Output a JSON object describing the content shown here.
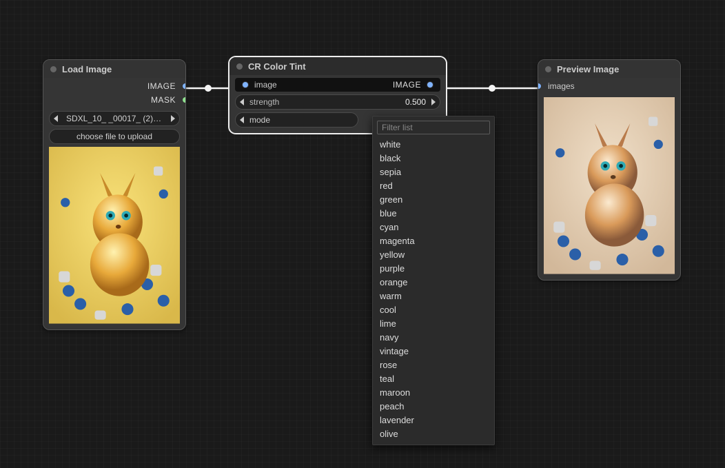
{
  "nodes": {
    "load_image": {
      "title": "Load Image",
      "outputs": {
        "image": "IMAGE",
        "mask": "MASK"
      },
      "widgets": {
        "file_name": "SDXL_10_ _00017_ (2).png",
        "upload_button": "choose file to upload"
      }
    },
    "cr_color_tint": {
      "title": "CR Color Tint",
      "inputs": {
        "image": "image"
      },
      "outputs": {
        "image": "IMAGE"
      },
      "widgets": {
        "strength_label": "strength",
        "strength_value": "0.500",
        "mode_label": "mode"
      }
    },
    "preview_image": {
      "title": "Preview Image",
      "inputs": {
        "images": "images"
      }
    }
  },
  "mode_dropdown": {
    "filter_placeholder": "Filter list",
    "options": [
      "white",
      "black",
      "sepia",
      "red",
      "green",
      "blue",
      "cyan",
      "magenta",
      "yellow",
      "purple",
      "orange",
      "warm",
      "cool",
      "lime",
      "navy",
      "vintage",
      "rose",
      "teal",
      "maroon",
      "peach",
      "lavender",
      "olive"
    ]
  }
}
